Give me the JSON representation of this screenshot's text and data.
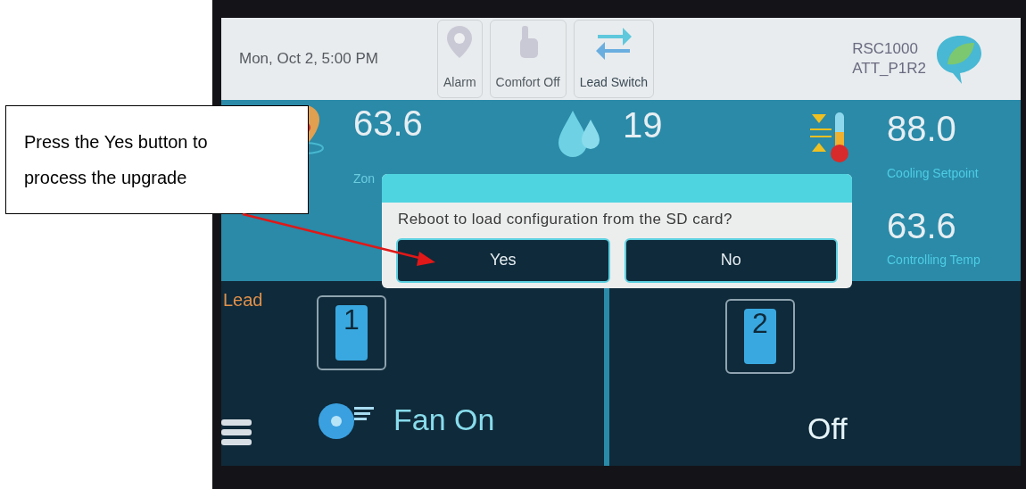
{
  "header": {
    "datetime": "Mon, Oct 2, 5:00 PM",
    "buttons": [
      {
        "kind": "alarm",
        "label": "Alarm",
        "disabled": true
      },
      {
        "kind": "comfort",
        "label": "Comfort Off",
        "disabled": true
      },
      {
        "kind": "lead_switch",
        "label": "Lead Switch",
        "disabled": false
      }
    ],
    "device": [
      "RSC1000",
      "ATT_P1R2"
    ]
  },
  "readings": [
    {
      "kind": "zone",
      "value": "63.6",
      "label": "Zon"
    },
    {
      "kind": "humidity",
      "value": "19"
    },
    {
      "kind": "setpoint",
      "value": "88.0",
      "label": "Cooling Setpoint"
    },
    {
      "kind": "controlling",
      "value": "63.6",
      "label": "Controlling Temp"
    }
  ],
  "units": [
    {
      "role": "Lead",
      "number": "1",
      "status": "Fan On",
      "fan": true
    },
    {
      "number": "2",
      "status": "Off",
      "fan": false
    }
  ],
  "dialog": {
    "message": "Reboot to load configuration from the SD card?",
    "buttons": [
      "Yes",
      "No"
    ]
  },
  "callout": {
    "text": "Press the Yes button to process the upgrade"
  }
}
